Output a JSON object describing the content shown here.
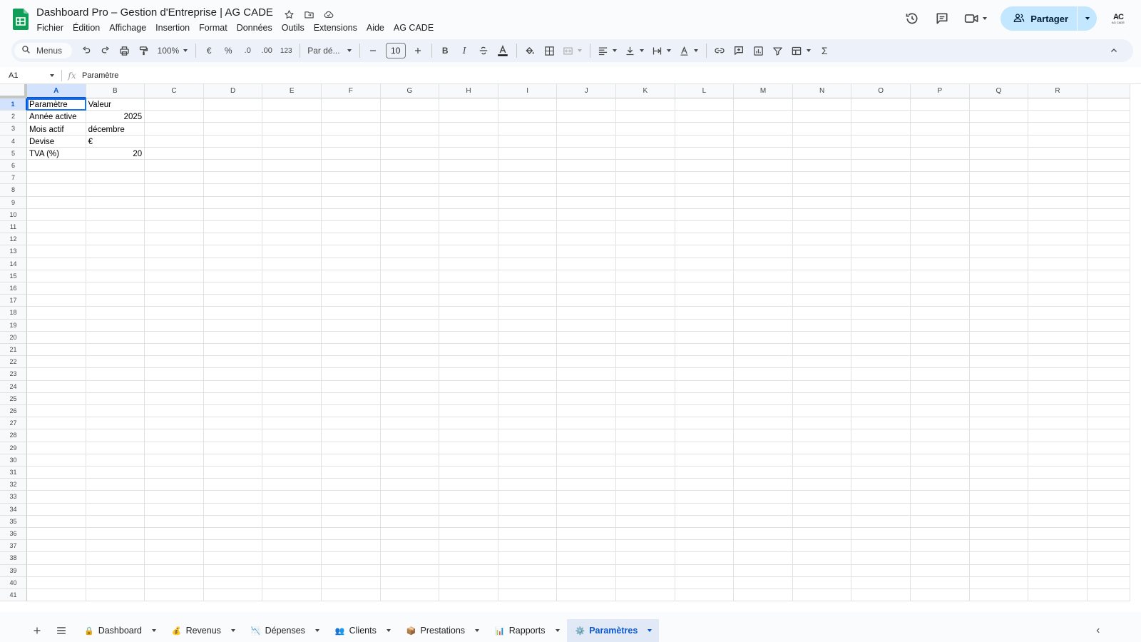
{
  "app": {
    "title": "Dashboard Pro – Gestion d'Entreprise | AG CADE",
    "menu": [
      "Fichier",
      "Édition",
      "Affichage",
      "Insertion",
      "Format",
      "Données",
      "Outils",
      "Extensions",
      "Aide",
      "AG CADE"
    ],
    "share_label": "Partager",
    "avatar_text": "AC",
    "avatar_sub": "AG CADE"
  },
  "toolbar": {
    "search_label": "Menus",
    "zoom": "100%",
    "currency": "€",
    "percent": "%",
    "dec_decrease": ".0",
    "dec_increase": ".00",
    "number_format": "123",
    "font": "Par dé...",
    "font_size": "10",
    "bold": "B",
    "italic": "I",
    "sum": "Σ"
  },
  "formula_bar": {
    "name_box": "A1",
    "fx": "fx",
    "value": "Paramètre"
  },
  "grid": {
    "columns": [
      "A",
      "B",
      "C",
      "D",
      "E",
      "F",
      "G",
      "H",
      "I",
      "J",
      "K",
      "L",
      "M",
      "N",
      "O",
      "P",
      "Q",
      "R"
    ],
    "selected_column": "A",
    "selected_row": "1",
    "rows": [
      {
        "a": "Paramètre",
        "b": "Valeur"
      },
      {
        "a": "Année active",
        "b": "2025"
      },
      {
        "a": "Mois actif",
        "b": "décembre"
      },
      {
        "a": "Devise",
        "b": "€"
      },
      {
        "a": "TVA (%)",
        "b": "20"
      }
    ],
    "row_count": 41
  },
  "sheets": [
    {
      "emoji": "🔒",
      "label": "Dashboard",
      "active": false
    },
    {
      "emoji": "💰",
      "label": "Revenus",
      "active": false
    },
    {
      "emoji": "📉",
      "label": "Dépenses",
      "active": false
    },
    {
      "emoji": "👥",
      "label": "Clients",
      "active": false
    },
    {
      "emoji": "📦",
      "label": "Prestations",
      "active": false
    },
    {
      "emoji": "📊",
      "label": "Rapports",
      "active": false
    },
    {
      "emoji": "⚙️",
      "label": "Paramètres",
      "active": true
    }
  ],
  "colors": {
    "accent": "#0b57d0",
    "selection": "#1a73e8",
    "share_bg": "#c2e7ff",
    "sheets_green": "#0f9d58"
  }
}
